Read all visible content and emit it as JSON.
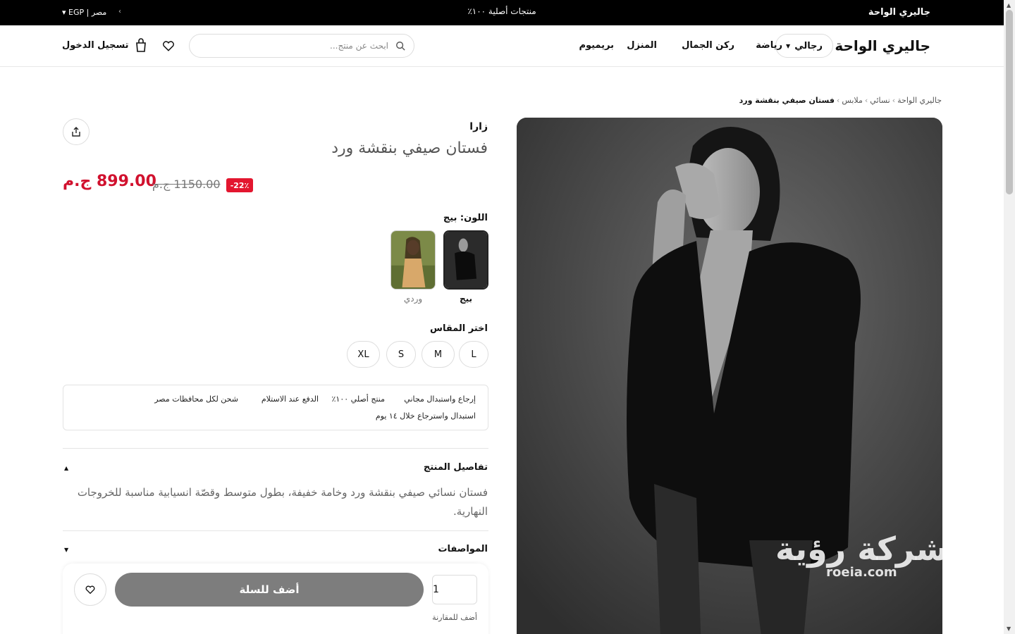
{
  "topbar": {
    "brand": "جاليري الواحة",
    "promo": "منتجات أصلية ١٠٠٪",
    "locale": "مصر | EGP"
  },
  "header": {
    "logo": "جاليري الواحة",
    "gender": "رجالي",
    "nav": [
      "رياضة",
      "ركن الجمال",
      "المنزل",
      "بريميوم"
    ],
    "search_placeholder": "ابحث عن منتج...",
    "login": "تسجيل الدخول"
  },
  "breadcrumb": {
    "items": [
      "جاليري الواحة",
      "نسائي",
      "ملابس"
    ],
    "current": "فستان صيفي بنقشة ورد"
  },
  "product": {
    "brand": "زارا",
    "title": "فستان صيفي بنقشة ورد",
    "price": "899.00 ج.م",
    "old_price": "1150.00 ج.م",
    "discount": "-22٪",
    "color_label": "اللون: بيج",
    "colors": [
      {
        "name": "بيج",
        "selected": true
      },
      {
        "name": "وردي",
        "selected": false
      }
    ],
    "size_label": "اختر المقاس",
    "sizes": [
      "L",
      "M",
      "S",
      "XL"
    ],
    "benefits": [
      "إرجاع واستبدال مجاني",
      "منتج أصلي ١٠٠٪",
      "الدفع عند الاستلام",
      "شحن لكل محافظات مصر"
    ],
    "benefit_row2": "استبدال واسترجاع خلال ١٤ يوم",
    "details_title": "تفاصيل المنتج",
    "details_body": "فستان نسائي صيفي بنقشة ورد وخامة خفيفة، بطول متوسط وقصّة انسيابية مناسبة للخروجات النهارية.",
    "specs_title": "المواصفات"
  },
  "cart": {
    "add_label": "أضف للسلة",
    "quantity": "1",
    "compare_label": "أضف للمقارنة"
  },
  "watermark": {
    "arabic": "شركة رؤية",
    "latin": "roeia.com"
  },
  "icons": {
    "search": "search-icon",
    "cart": "bag-icon",
    "wishlist": "heart-icon",
    "share": "share-icon"
  },
  "colors": {
    "price": "#d1112e",
    "badge": "#e3162f",
    "add_button": "#7d7d7d",
    "topbar": "#000000"
  }
}
